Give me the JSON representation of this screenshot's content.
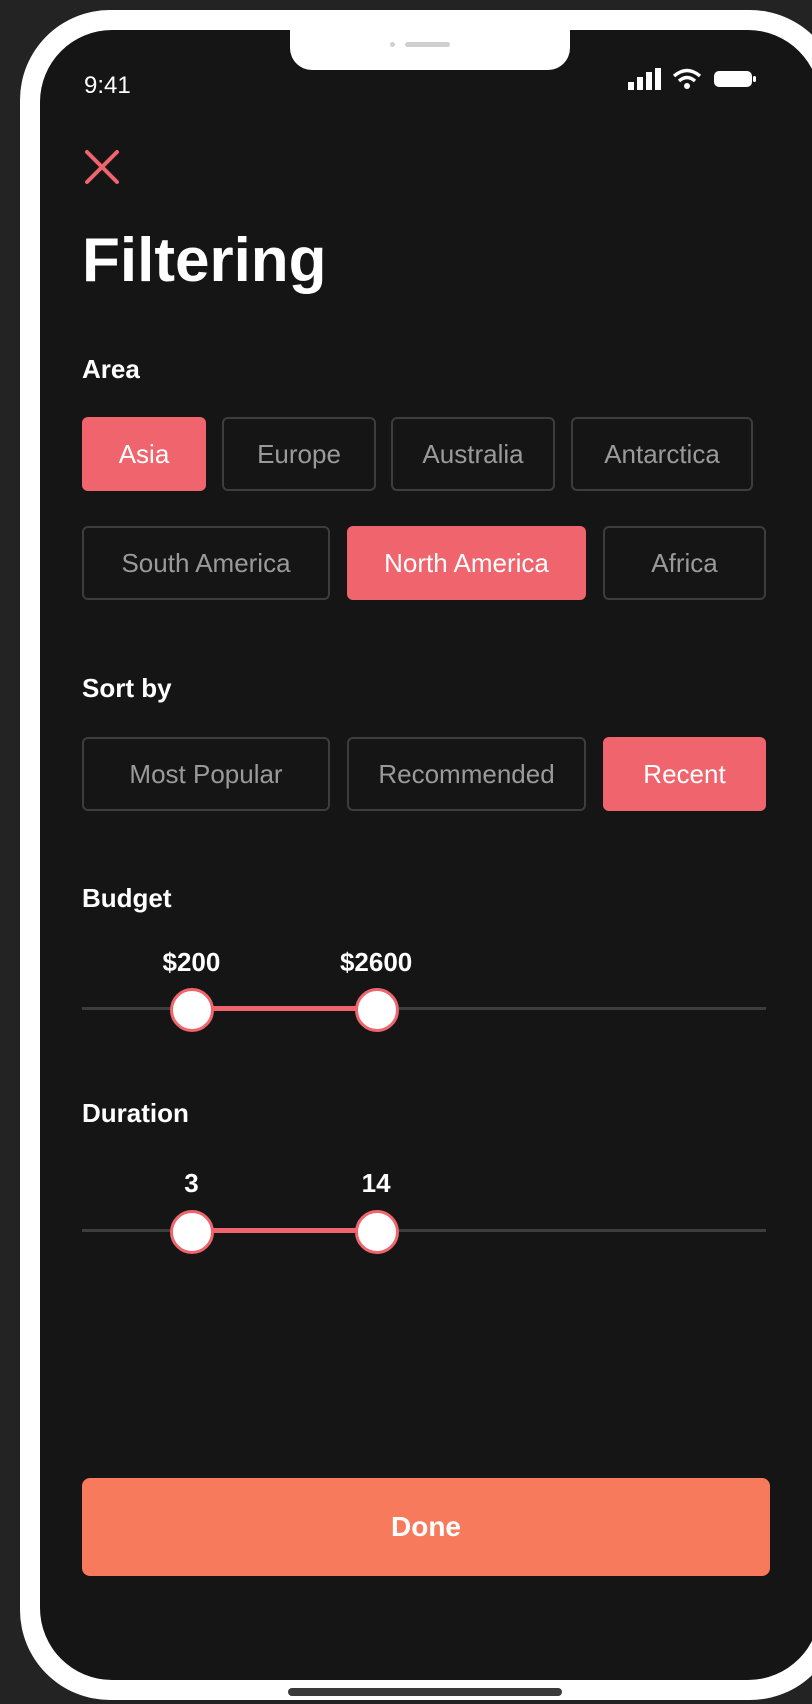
{
  "status_bar": {
    "time": "9:41"
  },
  "title": "Filtering",
  "area": {
    "label": "Area",
    "options": [
      {
        "label": "Asia",
        "selected": true
      },
      {
        "label": "Europe",
        "selected": false
      },
      {
        "label": "Australia",
        "selected": false
      },
      {
        "label": "Antarctica",
        "selected": false
      },
      {
        "label": "South America",
        "selected": false
      },
      {
        "label": "North America",
        "selected": true
      },
      {
        "label": "Africa",
        "selected": false
      }
    ]
  },
  "sort_by": {
    "label": "Sort by",
    "options": [
      {
        "label": "Most Popular",
        "selected": false
      },
      {
        "label": "Recommended",
        "selected": false
      },
      {
        "label": "Recent",
        "selected": true
      }
    ]
  },
  "budget": {
    "label": "Budget",
    "min_label": "$200",
    "max_label": "$2600",
    "low_fraction": 0.16,
    "high_fraction": 0.43
  },
  "duration": {
    "label": "Duration",
    "min_label": "3",
    "max_label": "14",
    "low_fraction": 0.16,
    "high_fraction": 0.43
  },
  "done_label": "Done",
  "colors": {
    "accent": "#f0646d",
    "done_button": "#f77a5c",
    "background": "#151515"
  },
  "icons": {
    "close": "close-icon",
    "signal": "signal-icon",
    "wifi": "wifi-icon",
    "battery": "battery-icon"
  }
}
